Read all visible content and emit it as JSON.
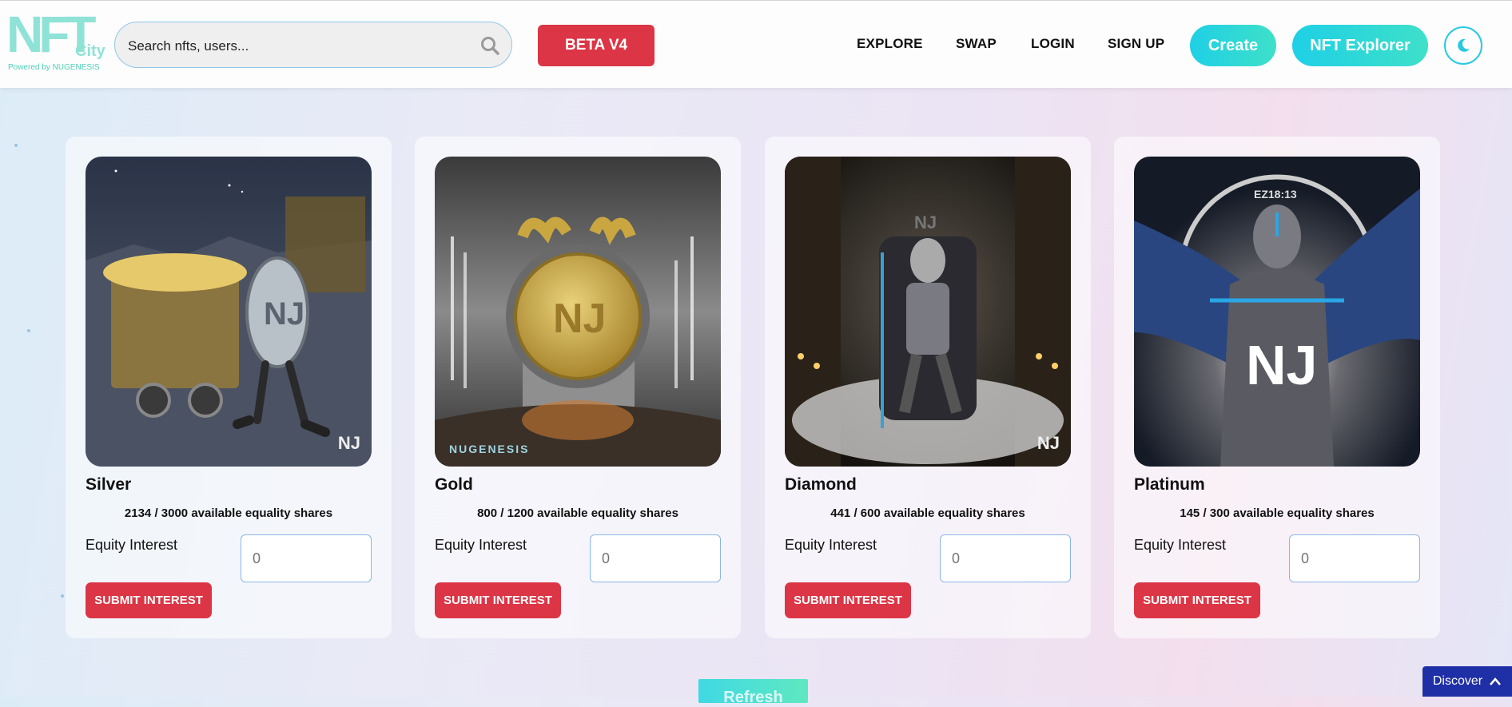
{
  "logo": {
    "nft": "NFT",
    "city": "City",
    "powered": "Powered by NUGENESIS"
  },
  "search": {
    "placeholder": "Search nfts, users..."
  },
  "beta_label": "BETA V4",
  "nav": [
    "EXPLORE",
    "SWAP",
    "LOGIN",
    "SIGN UP"
  ],
  "buttons": {
    "create": "Create",
    "nft_explorer": "NFT Explorer"
  },
  "cards": [
    {
      "title": "Silver",
      "shares": "2134 / 3000 available equality shares",
      "equity_label": "Equity Interest",
      "equity_placeholder": "0",
      "submit": "SUBMIT INTEREST"
    },
    {
      "title": "Gold",
      "shares": "800 / 1200 available equality shares",
      "equity_label": "Equity Interest",
      "equity_placeholder": "0",
      "submit": "SUBMIT INTEREST",
      "watermark": "NUGENESIS"
    },
    {
      "title": "Diamond",
      "shares": "441 / 600 available equality shares",
      "equity_label": "Equity Interest",
      "equity_placeholder": "0",
      "submit": "SUBMIT INTEREST"
    },
    {
      "title": "Platinum",
      "shares": "145 / 300 available equality shares",
      "equity_label": "Equity Interest",
      "equity_placeholder": "0",
      "submit": "SUBMIT INTEREST"
    }
  ],
  "refresh_label": "Refresh",
  "discover_label": "Discover",
  "colors": {
    "accent_red": "#dc3545",
    "accent_teal": "#1fd0e6",
    "discover_blue": "#1f2fa6"
  }
}
